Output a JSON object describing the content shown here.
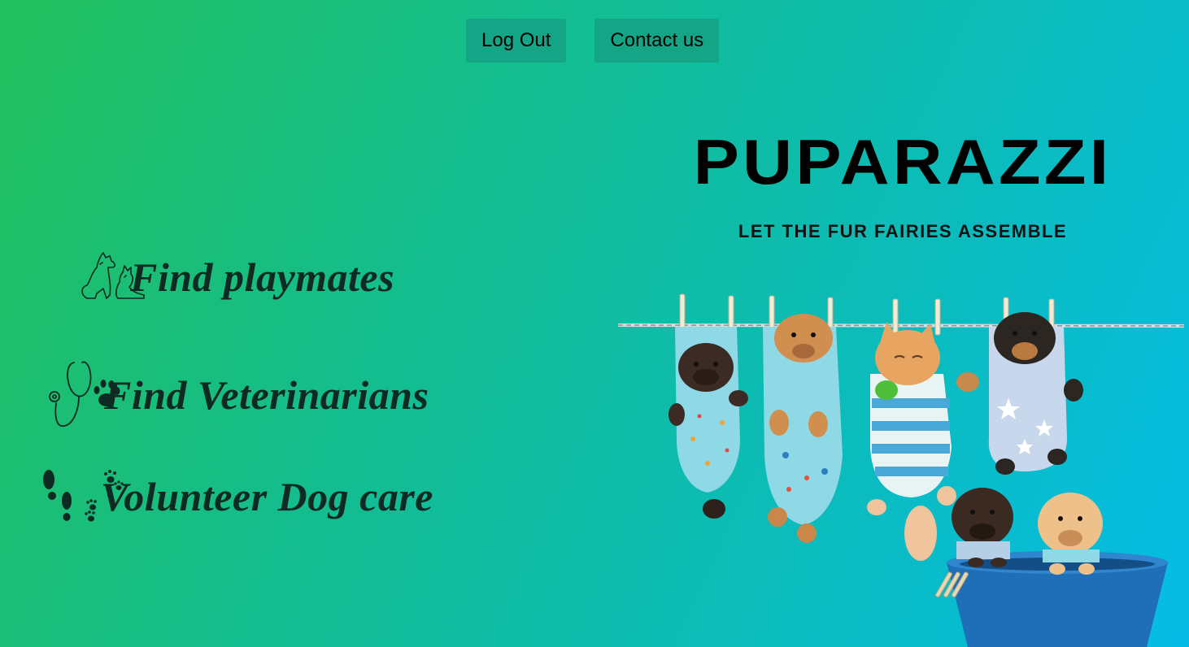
{
  "nav": {
    "logout_label": "Log Out",
    "contact_label": "Contact us"
  },
  "features": [
    {
      "label": "Find playmates",
      "icon": "dog-cat-icon"
    },
    {
      "label": "Find Veterinarians",
      "icon": "stethoscope-paw-icon"
    },
    {
      "label": "Volunteer Dog care",
      "icon": "footprints-paw-icon"
    }
  ],
  "brand": {
    "title": "PUPARAZZI",
    "tagline": "LET THE FUR FAIRIES ASSEMBLE"
  },
  "colors": {
    "gradient_start": "#22c05c",
    "gradient_end": "#05bce6",
    "button_bg": "#14a587",
    "feature_text": "#0f2a22"
  }
}
